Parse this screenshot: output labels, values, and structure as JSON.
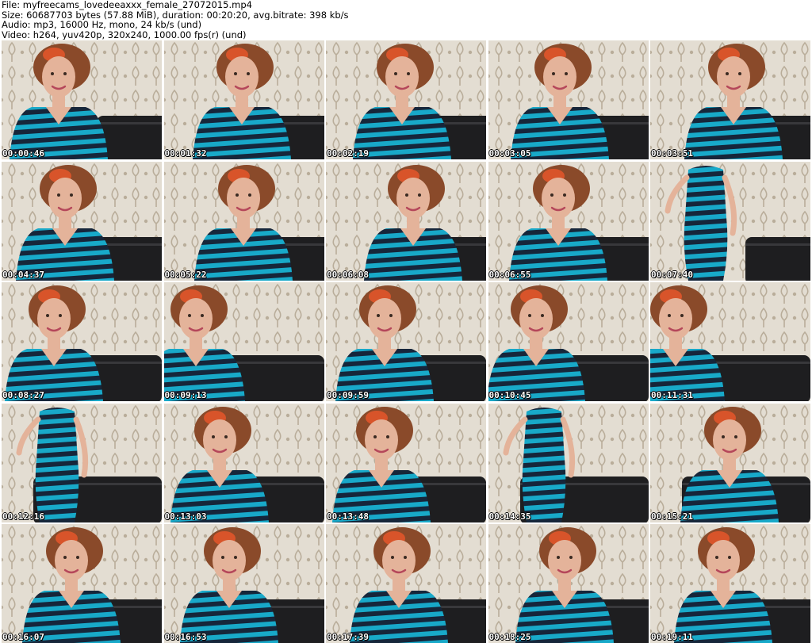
{
  "header": {
    "file_line": "File: myfreecams_lovedeeaxxx_female_27072015.mp4",
    "size_line": "Size: 60687703 bytes (57.88 MiB), duration: 00:20:20, avg.bitrate: 398 kb/s",
    "audio_line": "Audio: mp3, 16000 Hz, mono, 24 kb/s (und)",
    "video_line": "Video: h264, yuv420p, 320x240, 1000.00 fps(r) (und)"
  },
  "colors": {
    "wall": "#e3ddd2",
    "wall_pattern": "#b9ad9a",
    "couch": "#1e1e20",
    "stripe_a": "#18a9c9",
    "stripe_b": "#16263a",
    "skin": "#e4b39a",
    "hair": "#8a4a2a",
    "hair_highlight": "#d8542a"
  },
  "thumbnails": [
    {
      "timestamp": "00:00:46"
    },
    {
      "timestamp": "00:01:32"
    },
    {
      "timestamp": "00:02:19"
    },
    {
      "timestamp": "00:03:05"
    },
    {
      "timestamp": "00:03:51"
    },
    {
      "timestamp": "00:04:37"
    },
    {
      "timestamp": "00:05:22"
    },
    {
      "timestamp": "00:06:08"
    },
    {
      "timestamp": "00:06:55"
    },
    {
      "timestamp": "00:07:40"
    },
    {
      "timestamp": "00:08:27"
    },
    {
      "timestamp": "00:09:13"
    },
    {
      "timestamp": "00:09:59"
    },
    {
      "timestamp": "00:10:45"
    },
    {
      "timestamp": "00:11:31"
    },
    {
      "timestamp": "00:12:16"
    },
    {
      "timestamp": "00:13:03"
    },
    {
      "timestamp": "00:13:48"
    },
    {
      "timestamp": "00:14:35"
    },
    {
      "timestamp": "00:15:21"
    },
    {
      "timestamp": "00:16:07"
    },
    {
      "timestamp": "00:16:53"
    },
    {
      "timestamp": "00:17:39"
    },
    {
      "timestamp": "00:18:25"
    },
    {
      "timestamp": "00:19:11"
    }
  ]
}
